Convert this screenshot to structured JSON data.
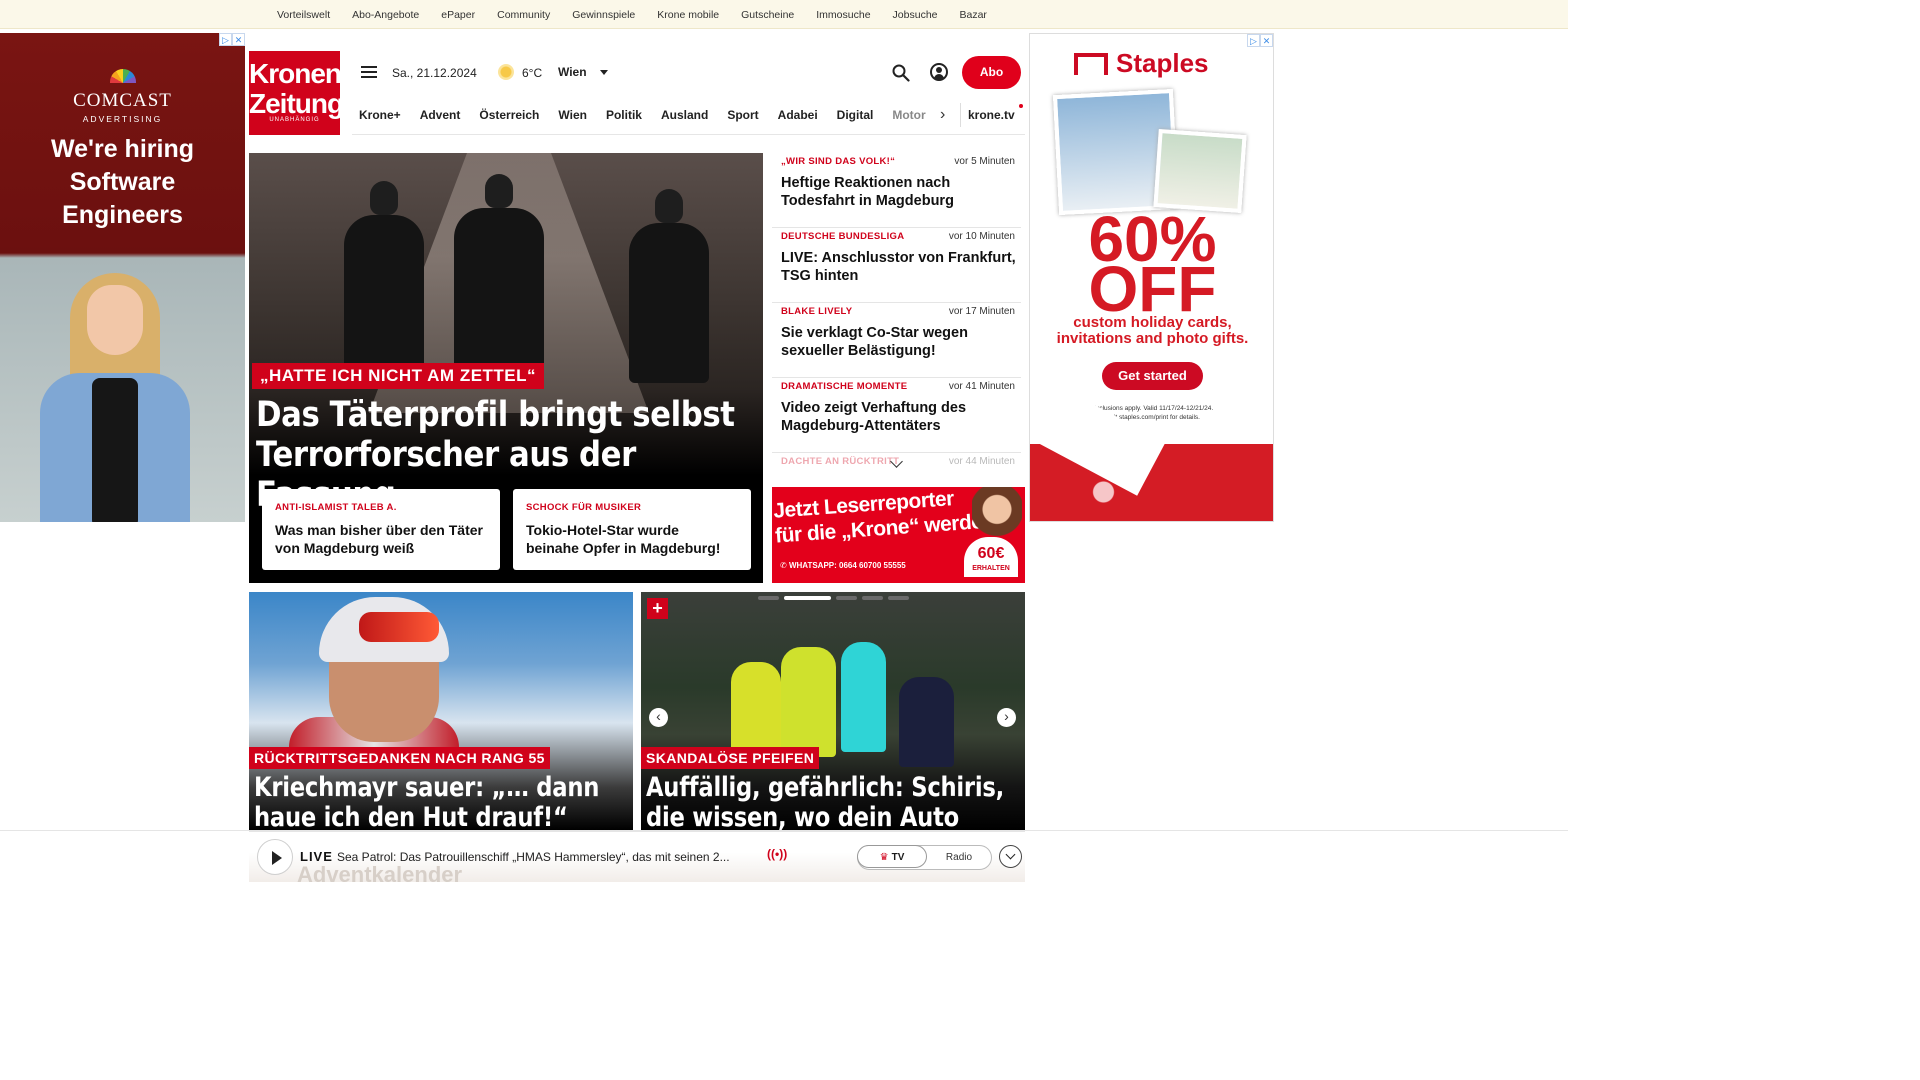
{
  "topbar": {
    "links": [
      "Vorteilswelt",
      "Abo-Angebote",
      "ePaper",
      "Community",
      "Gewinnspiele",
      "Krone mobile",
      "Gutscheine",
      "Immosuche",
      "Jobsuche",
      "Bazar"
    ]
  },
  "ad_left": {
    "brand": "COMCAST",
    "brand_sub": "ADVERTISING",
    "headline_1": "We're hiring",
    "headline_2": "Software",
    "headline_3": "Engineers"
  },
  "ad_right": {
    "brand": "Staples",
    "big_1": "60%",
    "big_2": "OFF",
    "sub_1": "custom holiday cards,",
    "sub_2": "invitations and photo gifts.",
    "cta": "Get started",
    "fine_1": "Exclusions apply. Valid 11/17/24-12/21/24.",
    "fine_2": "Visit staples.com/print for details."
  },
  "header": {
    "logo_line1": "Kronen",
    "logo_line2": "Zeitung",
    "logo_tagline": "UNABHÄNGIG",
    "date": "Sa., 21.12.2024",
    "temperature": "6°C",
    "city": "Wien",
    "abo_label": "Abo"
  },
  "nav": {
    "items": [
      "Krone+",
      "Advent",
      "Österreich",
      "Wien",
      "Politik",
      "Ausland",
      "Sport",
      "Adabei",
      "Digital",
      "Motor"
    ],
    "tv": "krone.tv"
  },
  "hero": {
    "kicker": "„HATTE ICH NICHT AM ZETTEL“",
    "title_1": "Das Täterprofil bringt selbst",
    "title_2": "Terrorforscher aus der Fassung",
    "subcards": [
      {
        "kicker": "ANTI-ISLAMIST TALEB A.",
        "title_1": "Was man bisher über den Täter",
        "title_2": "von Magdeburg weiß"
      },
      {
        "kicker": "SCHOCK FÜR MUSIKER",
        "title_1": "Tokio-Hotel-Star wurde",
        "title_2": "beinahe Opfer in Magdeburg!"
      }
    ]
  },
  "ticker": [
    {
      "kicker": "„WIR SIND DAS VOLK!“",
      "time": "vor 5 Minuten",
      "title_1": "Heftige Reaktionen nach",
      "title_2": "Todesfahrt in Magdeburg"
    },
    {
      "kicker": "DEUTSCHE BUNDESLIGA",
      "time": "vor 10 Minuten",
      "title_1": "LIVE: Anschlusstor von Frankfurt,",
      "title_2": "TSG hinten"
    },
    {
      "kicker": "BLAKE LIVELY",
      "time": "vor 17 Minuten",
      "title_1": "Sie verklagt Co-Star wegen",
      "title_2": "sexueller Belästigung!"
    },
    {
      "kicker": "DRAMATISCHE MOMENTE",
      "time": "vor 41 Minuten",
      "title_1": "Video zeigt Verhaftung des",
      "title_2": "Magdeburg-Attentäters"
    },
    {
      "kicker": "DACHTE AN RÜCKTRITT",
      "time": "vor 44 Minuten",
      "title_1": "",
      "title_2": ""
    }
  ],
  "promo": {
    "line_1": "Jetzt Leserreporter",
    "line_2": "für die „Krone“ werden",
    "whatsapp": "WHATSAPP: 0664 60700 55555",
    "amount": "60€",
    "amount_sub": "ERHALTEN"
  },
  "cards": [
    {
      "kicker": "RÜCKTRITTSGEDANKEN NACH RANG 55",
      "title_1": "Kriechmayr sauer: „… dann",
      "title_2": "haue ich den Hut drauf!“"
    },
    {
      "kicker": "SKANDALÖSE PFEIFEN",
      "title_1": "Auffällig, gefährlich: Schiris,",
      "title_2": "die wissen, wo dein Auto steht!"
    }
  ],
  "player": {
    "live_label": "LIVE",
    "now_playing": "Sea Patrol: Das Patrouillenschiff „HMAS Hammersley“, das mit seinen 2...",
    "tv_label": "TV",
    "radio_label": "Radio",
    "background_text": "Adventkalender"
  }
}
